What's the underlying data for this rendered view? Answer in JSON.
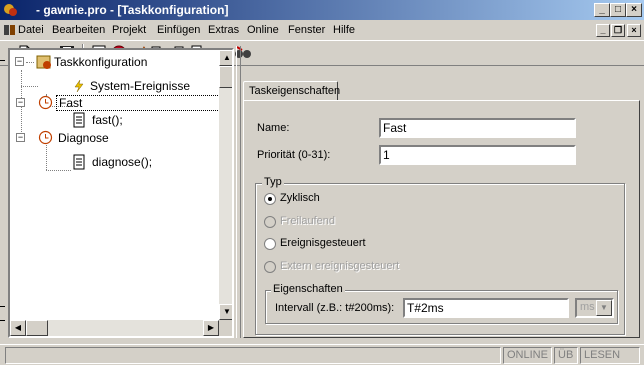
{
  "window": {
    "title": "  - gawnie.pro - [Taskkonfiguration]",
    "minimize": "_",
    "maximize": "□",
    "close": "×"
  },
  "menubar": {
    "items": [
      "Datei",
      "Bearbeiten",
      "Projekt",
      "Einfügen",
      "Extras",
      "Online",
      "Fenster",
      "Hilfe"
    ],
    "mdi_minimize": "_",
    "mdi_restore": "❐",
    "mdi_close": "×"
  },
  "toolbar": {
    "icons": [
      "new-file-icon",
      "open-folder-icon",
      "save-icon",
      "build-icon",
      "stop-icon",
      "login-icon",
      "compile-icon",
      "print-icon",
      "copy-icon",
      "find-icon",
      "find-replace-icon"
    ]
  },
  "tree": {
    "root": "Taskkonfiguration",
    "system_events": "System-Ereignisse",
    "task_fast": "Fast",
    "pou_fast": "fast();",
    "task_diagnose": "Diagnose",
    "pou_diagnose": "diagnose();"
  },
  "properties": {
    "tab_label": "Taskeigenschaften",
    "name_label": "Name:",
    "name_value": "Fast",
    "priority_label": "Priorität (0-31):",
    "priority_value": "1",
    "type_group": "Typ",
    "type_options": [
      {
        "label": "Zyklisch",
        "checked": true,
        "enabled": true
      },
      {
        "label": "Freilaufend",
        "checked": false,
        "enabled": false
      },
      {
        "label": "Ereignisgesteuert",
        "checked": false,
        "enabled": true
      },
      {
        "label": "Extern ereignisgesteuert",
        "checked": false,
        "enabled": false
      }
    ],
    "props_group": "Eigenschaften",
    "interval_label": "Intervall (z.B.: t#200ms):",
    "interval_value": "T#2ms",
    "unit_value": "ms"
  },
  "statusbar": {
    "online": "ONLINE",
    "ub": "ÜB",
    "lesen": "LESEN"
  },
  "colors": {
    "titlebar_start": "#0a246a",
    "titlebar_end": "#a6caf0",
    "face": "#d4d0c8"
  }
}
